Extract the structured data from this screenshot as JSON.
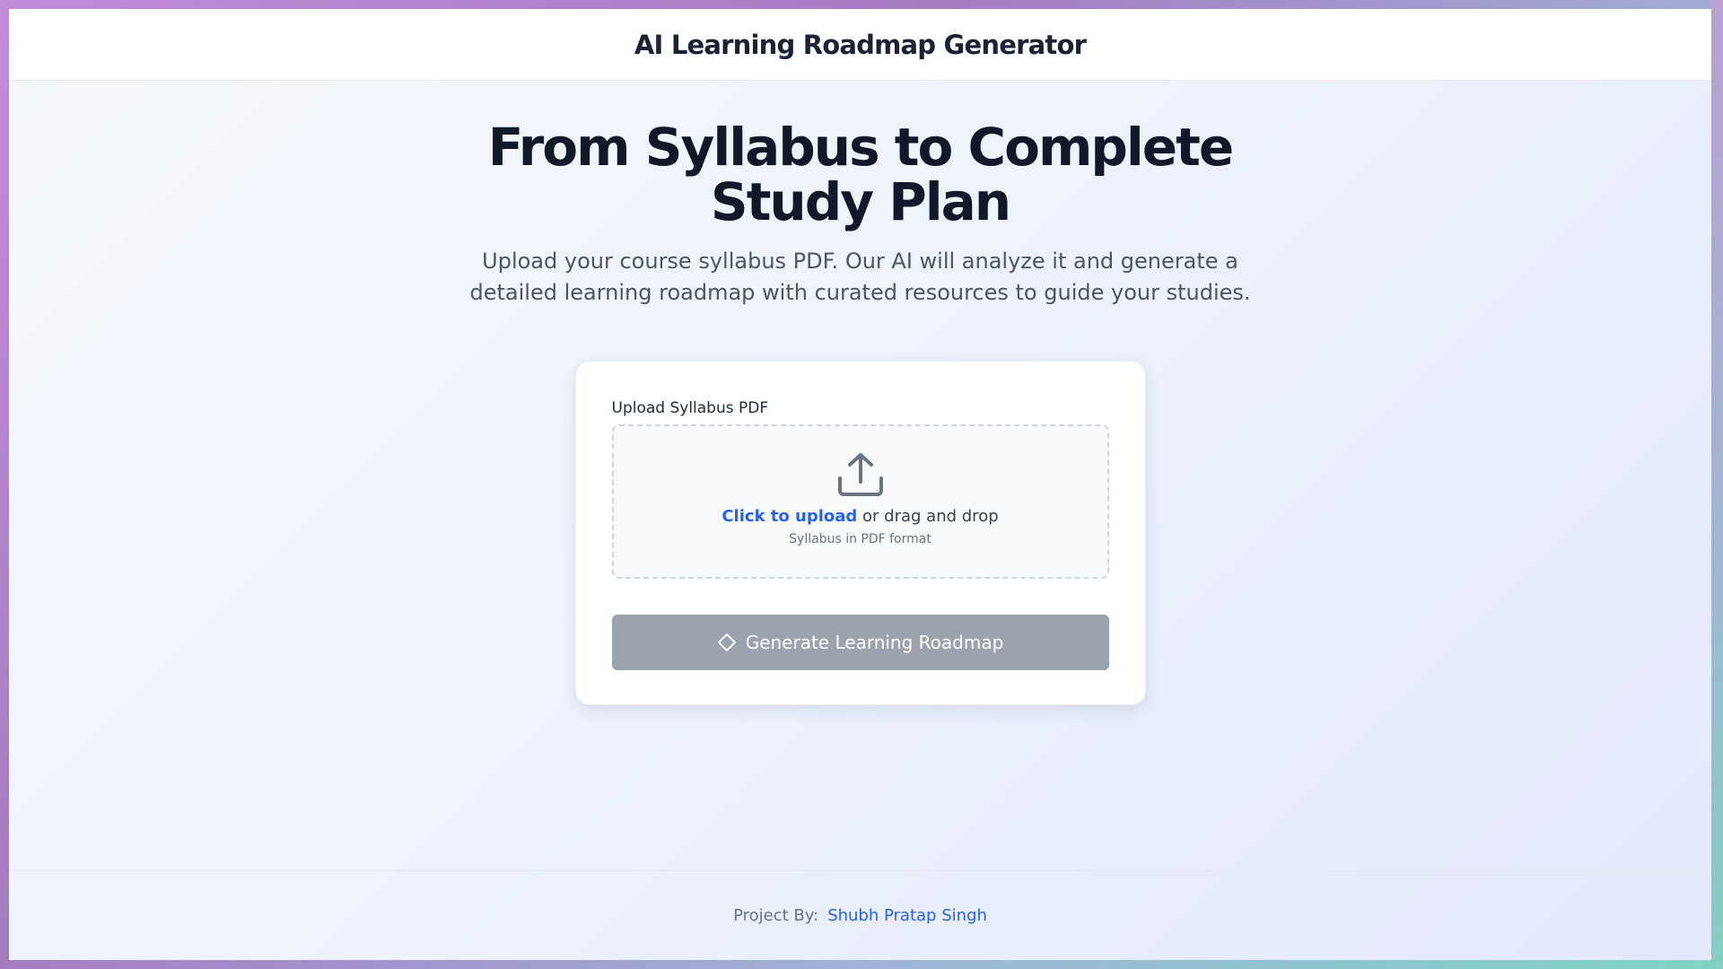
{
  "header": {
    "title": "AI Learning Roadmap Generator"
  },
  "hero": {
    "title": "From Syllabus to Complete Study Plan",
    "subtitle": "Upload your course syllabus PDF. Our AI will analyze it and generate a detailed learning roadmap with curated resources to guide your studies."
  },
  "upload": {
    "label": "Upload Syllabus PDF",
    "icon": "upload-icon",
    "link_text": "Click to upload",
    "rest_text": " or drag and drop",
    "hint": "Syllabus in PDF format"
  },
  "generate_button": {
    "label": "Generate Learning Roadmap",
    "icon": "tag-icon",
    "state": "disabled"
  },
  "footer": {
    "prefix": "Project By:",
    "author": "Shubh Pratap Singh"
  },
  "colors": {
    "accent": "#2563eb",
    "heading": "#111827",
    "button_disabled": "#9ca3af"
  }
}
